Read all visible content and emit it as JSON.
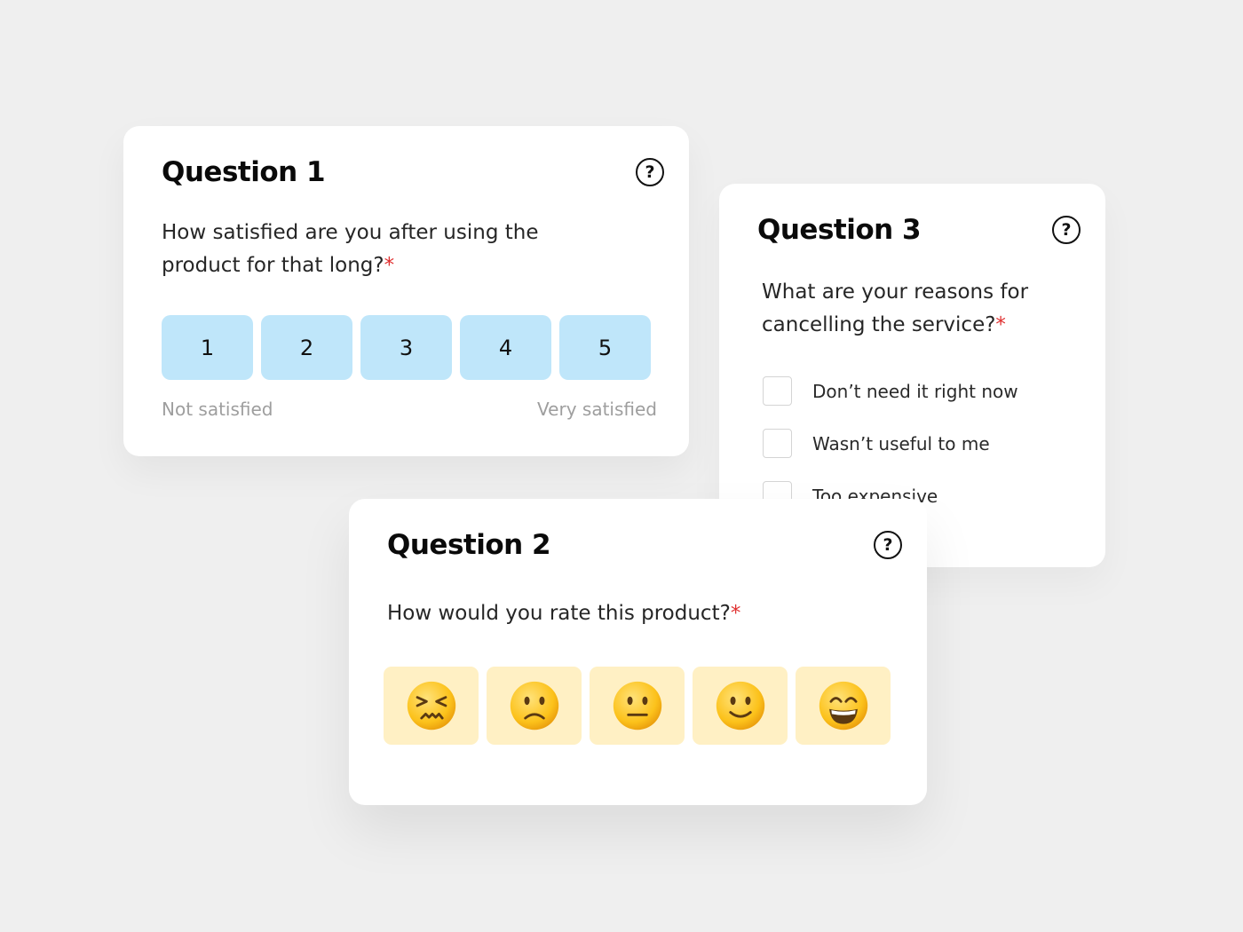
{
  "question1": {
    "title": "Question 1",
    "help_icon": "question-mark-circle-icon",
    "text": "How satisfied are you after using the product for that long?",
    "required_mark": "*",
    "scale": [
      "1",
      "2",
      "3",
      "4",
      "5"
    ],
    "low_label": "Not satisfied",
    "high_label": "Very satisfied",
    "scale_color": "#bfe6fa"
  },
  "question3": {
    "title": "Question 3",
    "help_icon": "question-mark-circle-icon",
    "text": "What are your reasons for cancelling the service?",
    "required_mark": "*",
    "options": [
      "Don’t need it right now",
      "Wasn’t useful to me",
      "Too expensive"
    ]
  },
  "question2": {
    "title": "Question 2",
    "help_icon": "question-mark-circle-icon",
    "text": "How would you rate this product?",
    "required_mark": "*",
    "ratings": [
      {
        "icon": "persevering-face-icon"
      },
      {
        "icon": "slightly-frowning-face-icon"
      },
      {
        "icon": "neutral-face-icon"
      },
      {
        "icon": "slightly-smiling-face-icon"
      },
      {
        "icon": "grinning-face-icon"
      }
    ],
    "rating_color": "#fff0c4"
  },
  "colors": {
    "background": "#efefef",
    "required": "#e03131",
    "muted_text": "#9e9e9e"
  }
}
